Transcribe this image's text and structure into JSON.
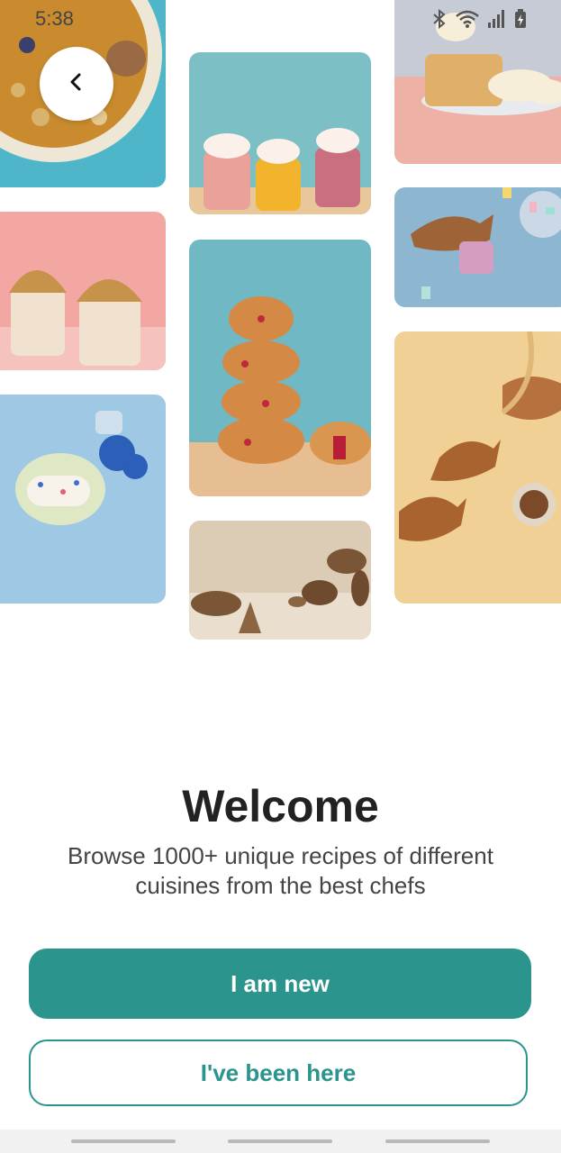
{
  "status_bar": {
    "time": "5:38",
    "icons": [
      "bluetooth-icon",
      "wifi-icon",
      "signal-icon",
      "battery-charging-icon"
    ]
  },
  "back_button": {
    "icon": "chevron-left-icon"
  },
  "gallery": {
    "tiles": [
      "granola-bowl-image",
      "smoothie-cups-image",
      "cheesecake-image",
      "whipped-coffee-image",
      "donut-stack-image",
      "taiyaki-candy-image",
      "sprinkle-roll-image",
      "taiyaki-chocolate-image",
      "bread-loaves-image"
    ]
  },
  "welcome": {
    "title": "Welcome",
    "subtitle": "Browse 1000+ unique recipes of different cuisines from the best chefs"
  },
  "actions": {
    "primary_label": "I am new",
    "secondary_label": "I've been here"
  },
  "colors": {
    "accent": "#2a948d",
    "background": "#ffffff",
    "title_text": "#222222"
  }
}
